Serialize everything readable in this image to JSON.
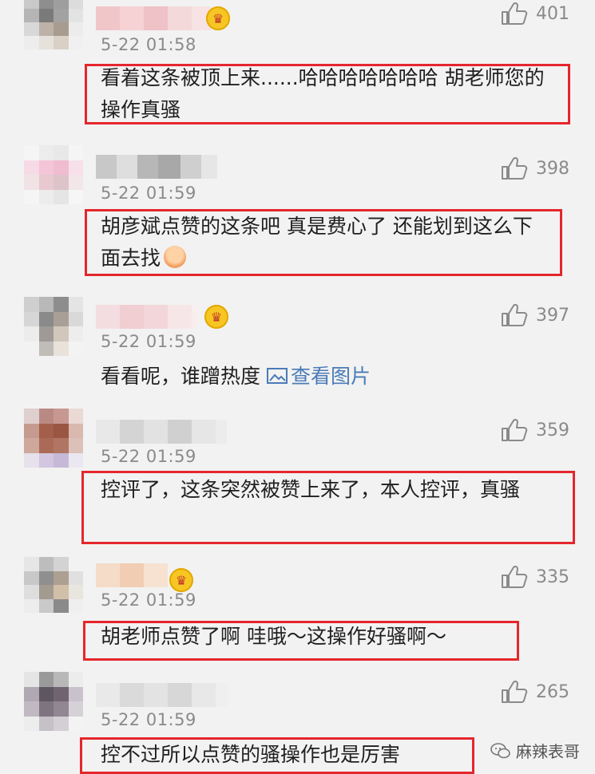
{
  "comments": [
    {
      "time": "5-22 01:58",
      "likes": "401",
      "text": "看着这条被顶上来......哈哈哈哈哈哈哈 胡老师您的操作真骚",
      "vip": true
    },
    {
      "time": "5-22 01:59",
      "likes": "398",
      "text": "胡彦斌点赞的这条吧 真是费心了 还能划到这么下面去找",
      "vip": false
    },
    {
      "time": "5-22 01:59",
      "likes": "397",
      "text": "看看呢，谁蹭热度 ",
      "link": "查看图片",
      "vip": true
    },
    {
      "time": "5-22 01:59",
      "likes": "359",
      "text": "控评了，这条突然被赞上来了，本人控评，真骚",
      "vip": false
    },
    {
      "time": "5-22 01:59",
      "likes": "335",
      "text": "胡老师点赞了啊  哇哦～这操作好骚啊～",
      "vip": true
    },
    {
      "time": "5-22 01:59",
      "likes": "265",
      "text": "控不过所以点赞的骚操作也是厉害",
      "vip": false
    }
  ],
  "watermark": "麻辣表哥",
  "icons": {
    "like": "thumbs-up-icon",
    "vip": "crown-badge-icon",
    "image": "image-icon",
    "watermark": "wechat-icon",
    "emoji": "laughing-face-icon"
  },
  "colors": {
    "highlight_box": "#e5262c",
    "link": "#4a7bb7",
    "meta": "#8a8a8a"
  }
}
